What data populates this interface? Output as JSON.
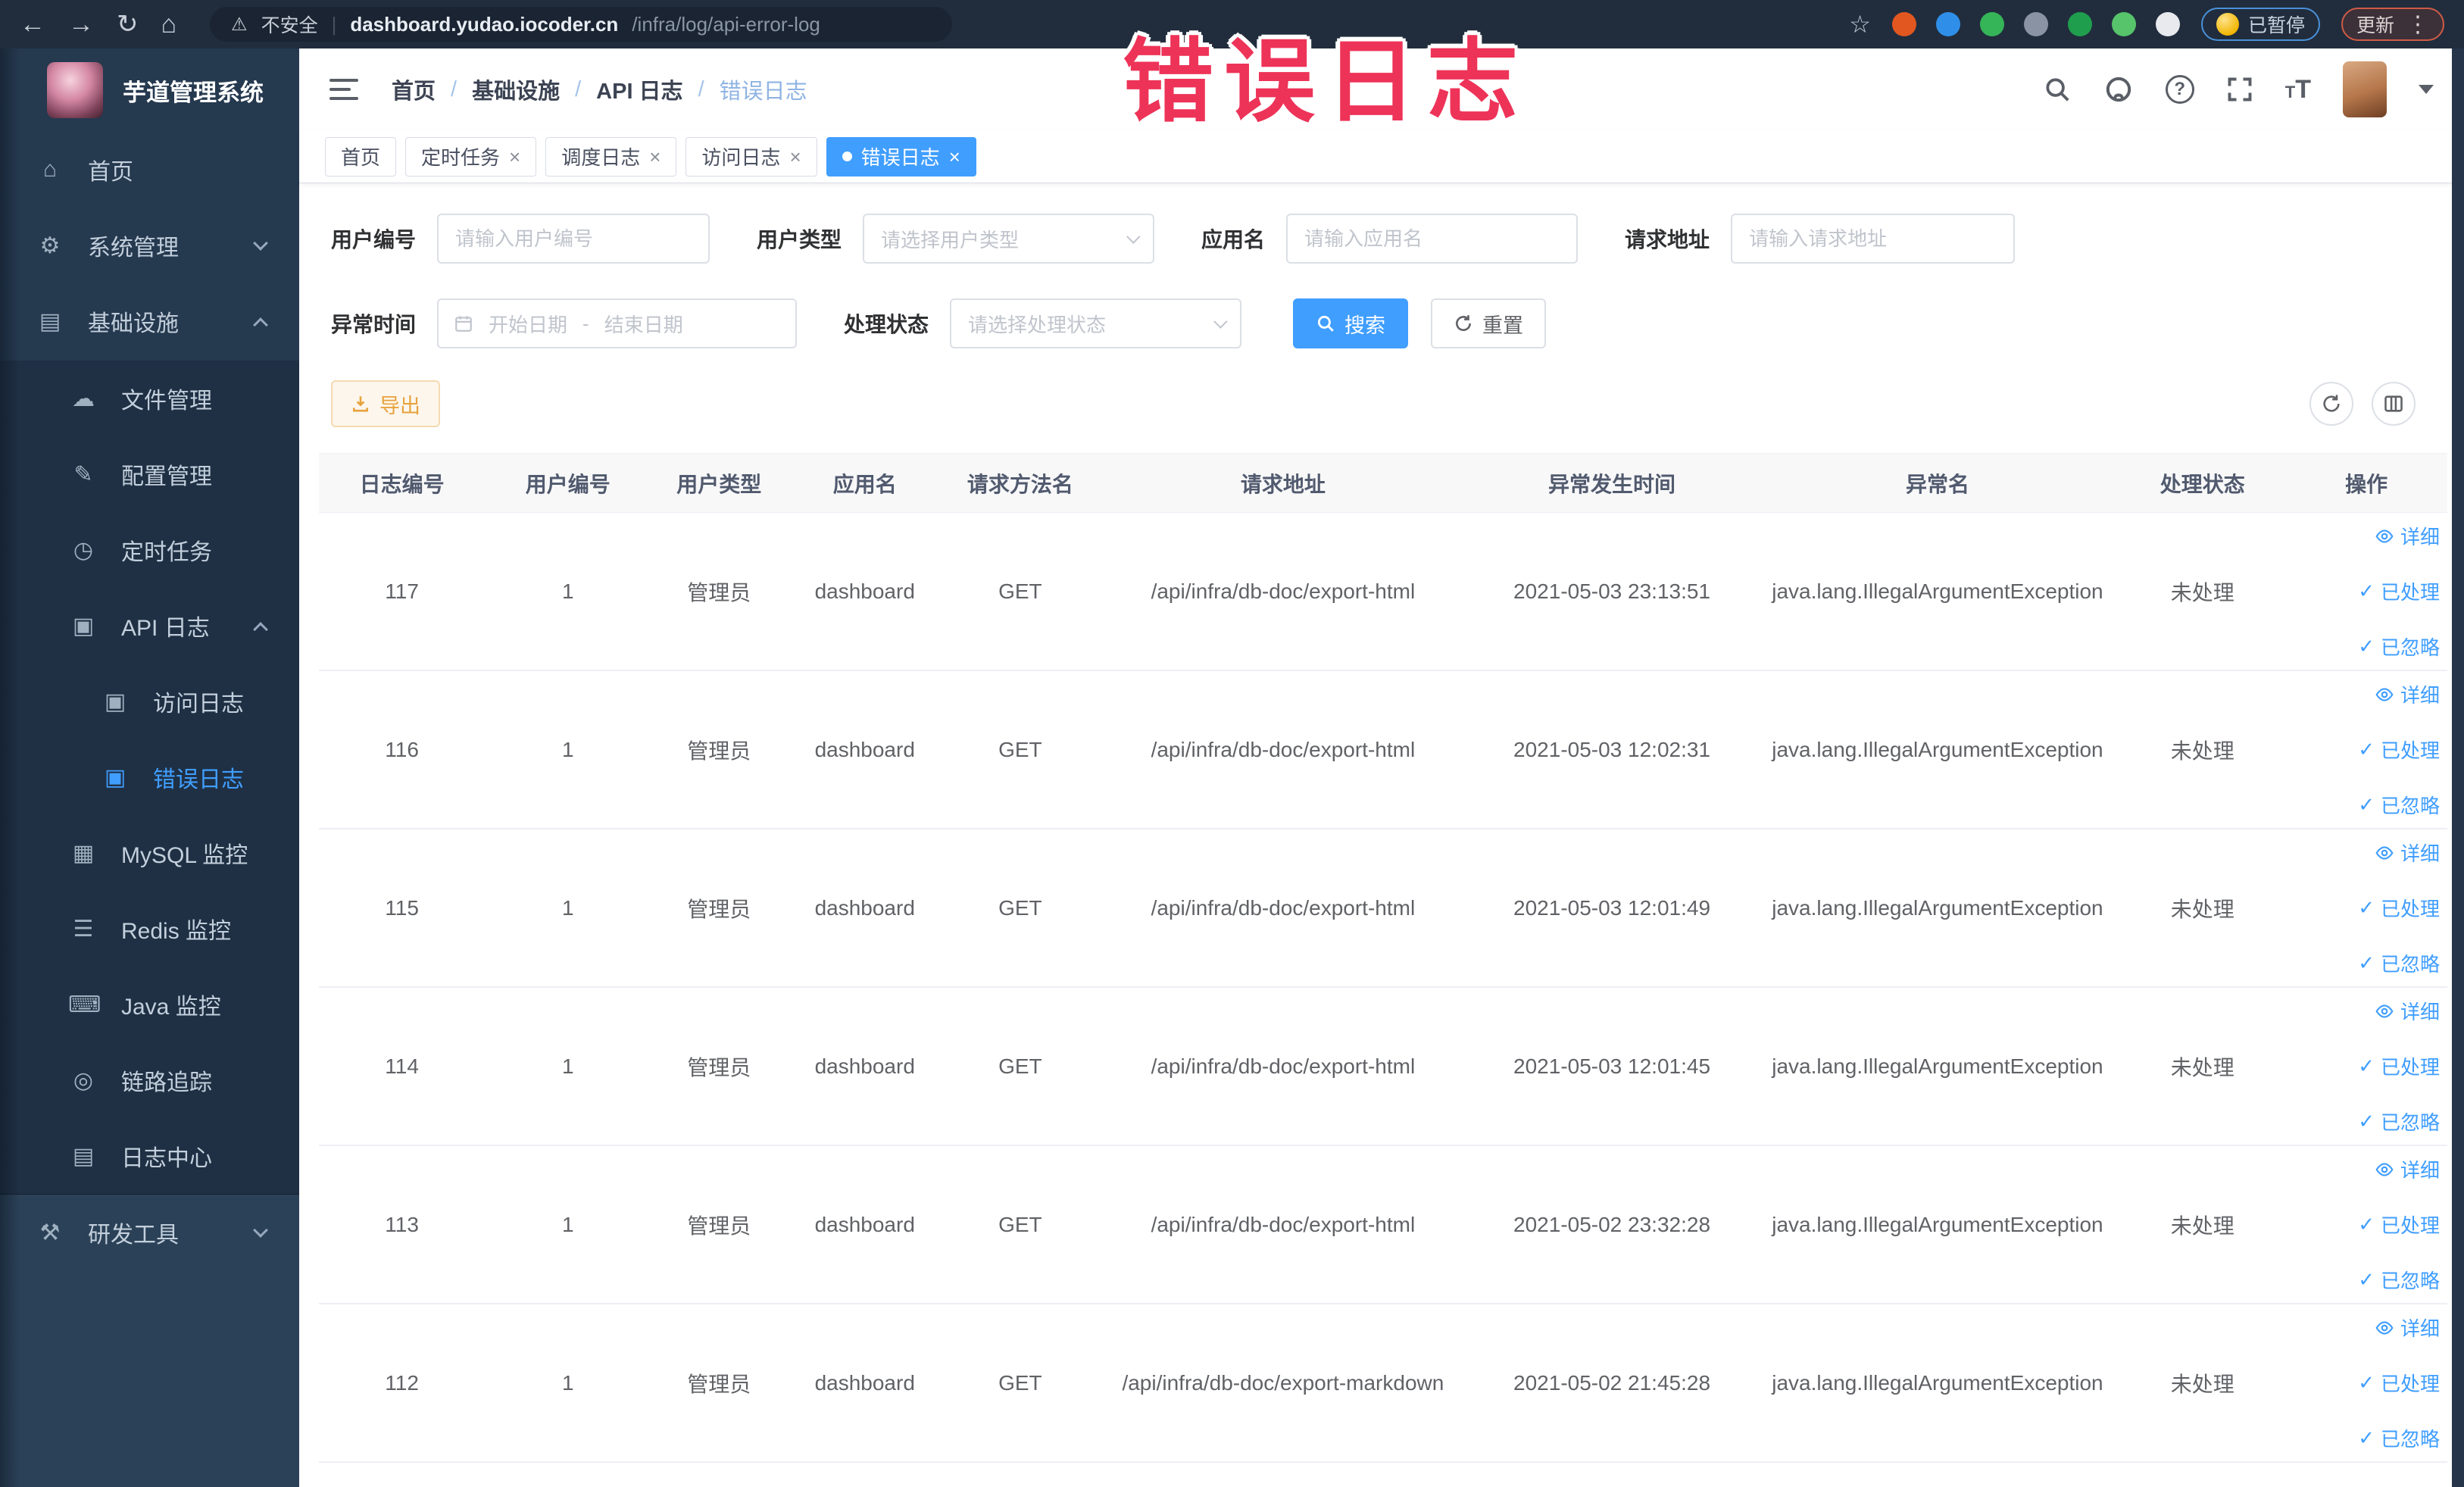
{
  "colors": {
    "accent": "#409eff",
    "warning": "#e6a23c",
    "annotation_pink": "#ee3358",
    "sidebar_dark": "#1f3044"
  },
  "annotation": {
    "text": "错误日志"
  },
  "browser": {
    "security_text": "不安全",
    "url_host": "dashboard.yudao.iocoder.cn",
    "url_path": "/infra/log/api-error-log",
    "paused_pill": "已暂停",
    "update_pill": "更新",
    "extensions": [
      {
        "icon": "adblock-icon",
        "color": "#e2571f"
      },
      {
        "icon": "vpn-shield-icon",
        "color": "#2f8fe8"
      },
      {
        "icon": "green-v-icon",
        "color": "#35b558"
      },
      {
        "icon": "tab-grid-icon",
        "color": "#8a93a3"
      },
      {
        "icon": "switch-on-icon",
        "color": "#1f9e4e"
      },
      {
        "icon": "sprout-icon",
        "color": "#57c36a"
      },
      {
        "icon": "extensions-puzzle-icon",
        "color": "#e8eaed"
      }
    ]
  },
  "sidebar": {
    "title": "芋道管理系统",
    "top_items": [
      {
        "key": "home",
        "icon": "home-icon",
        "label": "首页",
        "level": 0
      },
      {
        "key": "system-management",
        "icon": "settings-gear-icon",
        "label": "系统管理",
        "level": 0,
        "chevron": "down"
      },
      {
        "key": "infrastructure",
        "icon": "infrastructure-icon",
        "label": "基础设施",
        "level": 0,
        "chevron": "up"
      }
    ],
    "submenu_items": [
      {
        "key": "file-management",
        "icon": "file-upload-icon",
        "label": "文件管理",
        "level": 1
      },
      {
        "key": "config-management",
        "icon": "config-edit-icon",
        "label": "配置管理",
        "level": 1
      },
      {
        "key": "scheduled-tasks",
        "icon": "timer-icon",
        "label": "定时任务",
        "level": 1
      },
      {
        "key": "api-log",
        "icon": "api-log-icon",
        "label": "API 日志",
        "level": 1,
        "chevron": "up"
      },
      {
        "key": "access-log",
        "icon": "access-log-icon",
        "label": "访问日志",
        "level": 2
      },
      {
        "key": "error-log",
        "icon": "error-log-icon",
        "label": "错误日志",
        "level": 2,
        "active": true
      },
      {
        "key": "mysql-monitor",
        "icon": "mysql-monitor-icon",
        "label": "MySQL 监控",
        "level": 1
      },
      {
        "key": "redis-monitor",
        "icon": "redis-monitor-icon",
        "label": "Redis 监控",
        "level": 1
      },
      {
        "key": "java-monitor",
        "icon": "java-monitor-icon",
        "label": "Java 监控",
        "level": 1
      },
      {
        "key": "trace",
        "icon": "trace-icon",
        "label": "链路追踪",
        "level": 1
      },
      {
        "key": "log-center",
        "icon": "log-center-icon",
        "label": "日志中心",
        "level": 1
      }
    ],
    "bottom_items": [
      {
        "key": "dev-tools",
        "icon": "dev-tools-icon",
        "label": "研发工具",
        "level": 0,
        "chevron": "down"
      }
    ]
  },
  "header": {
    "breadcrumb": [
      "首页",
      "基础设施",
      "API 日志",
      "错误日志"
    ]
  },
  "tabs": [
    {
      "key": "home",
      "label": "首页",
      "closable": false
    },
    {
      "key": "scheduled-tasks",
      "label": "定时任务",
      "closable": true
    },
    {
      "key": "schedule-log",
      "label": "调度日志",
      "closable": true
    },
    {
      "key": "access-log",
      "label": "访问日志",
      "closable": true
    },
    {
      "key": "error-log",
      "label": "错误日志",
      "closable": true,
      "active": true
    }
  ],
  "filters": {
    "user_no": {
      "label": "用户编号",
      "placeholder": "请输入用户编号"
    },
    "user_type": {
      "label": "用户类型",
      "placeholder": "请选择用户类型"
    },
    "app_name": {
      "label": "应用名",
      "placeholder": "请输入应用名"
    },
    "request_url": {
      "label": "请求地址",
      "placeholder": "请输入请求地址"
    },
    "exception_time": {
      "label": "异常时间",
      "start_placeholder": "开始日期",
      "separator": "-",
      "end_placeholder": "结束日期"
    },
    "process_status": {
      "label": "处理状态",
      "placeholder": "请选择处理状态"
    },
    "search_label": "搜索",
    "reset_label": "重置"
  },
  "toolbar": {
    "export_label": "导出"
  },
  "table": {
    "columns": [
      "日志编号",
      "用户编号",
      "用户类型",
      "应用名",
      "请求方法名",
      "请求地址",
      "异常发生时间",
      "异常名",
      "处理状态",
      "操作"
    ],
    "rows": [
      {
        "log_id": "117",
        "user_id": "1",
        "user_type": "管理员",
        "app_name": "dashboard",
        "method": "GET",
        "url": "/api/infra/db-doc/export-html",
        "time": "2021-05-03 23:13:51",
        "exception": "java.lang.IllegalArgumentException",
        "status": "未处理"
      },
      {
        "log_id": "116",
        "user_id": "1",
        "user_type": "管理员",
        "app_name": "dashboard",
        "method": "GET",
        "url": "/api/infra/db-doc/export-html",
        "time": "2021-05-03 12:02:31",
        "exception": "java.lang.IllegalArgumentException",
        "status": "未处理"
      },
      {
        "log_id": "115",
        "user_id": "1",
        "user_type": "管理员",
        "app_name": "dashboard",
        "method": "GET",
        "url": "/api/infra/db-doc/export-html",
        "time": "2021-05-03 12:01:49",
        "exception": "java.lang.IllegalArgumentException",
        "status": "未处理"
      },
      {
        "log_id": "114",
        "user_id": "1",
        "user_type": "管理员",
        "app_name": "dashboard",
        "method": "GET",
        "url": "/api/infra/db-doc/export-html",
        "time": "2021-05-03 12:01:45",
        "exception": "java.lang.IllegalArgumentException",
        "status": "未处理"
      },
      {
        "log_id": "113",
        "user_id": "1",
        "user_type": "管理员",
        "app_name": "dashboard",
        "method": "GET",
        "url": "/api/infra/db-doc/export-html",
        "time": "2021-05-02 23:32:28",
        "exception": "java.lang.IllegalArgumentException",
        "status": "未处理"
      },
      {
        "log_id": "112",
        "user_id": "1",
        "user_type": "管理员",
        "app_name": "dashboard",
        "method": "GET",
        "url": "/api/infra/db-doc/export-markdown",
        "time": "2021-05-02 21:45:28",
        "exception": "java.lang.IllegalArgumentException",
        "status": "未处理"
      }
    ],
    "row_actions": [
      {
        "label": "详细",
        "icon": "eye-icon"
      },
      {
        "label": "已处理",
        "icon": "check-icon"
      },
      {
        "label": "已忽略",
        "icon": "check-icon"
      }
    ]
  }
}
